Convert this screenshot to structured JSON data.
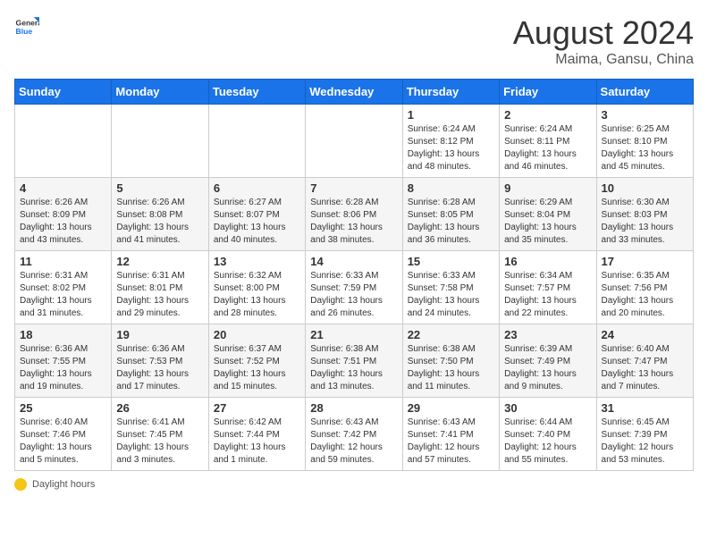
{
  "header": {
    "logo_general": "General",
    "logo_blue": "Blue",
    "month_year": "August 2024",
    "location": "Maima, Gansu, China"
  },
  "weekdays": [
    "Sunday",
    "Monday",
    "Tuesday",
    "Wednesday",
    "Thursday",
    "Friday",
    "Saturday"
  ],
  "footer": {
    "daylight_label": "Daylight hours"
  },
  "weeks": [
    [
      {
        "day": "",
        "info": ""
      },
      {
        "day": "",
        "info": ""
      },
      {
        "day": "",
        "info": ""
      },
      {
        "day": "",
        "info": ""
      },
      {
        "day": "1",
        "info": "Sunrise: 6:24 AM\nSunset: 8:12 PM\nDaylight: 13 hours\nand 48 minutes."
      },
      {
        "day": "2",
        "info": "Sunrise: 6:24 AM\nSunset: 8:11 PM\nDaylight: 13 hours\nand 46 minutes."
      },
      {
        "day": "3",
        "info": "Sunrise: 6:25 AM\nSunset: 8:10 PM\nDaylight: 13 hours\nand 45 minutes."
      }
    ],
    [
      {
        "day": "4",
        "info": "Sunrise: 6:26 AM\nSunset: 8:09 PM\nDaylight: 13 hours\nand 43 minutes."
      },
      {
        "day": "5",
        "info": "Sunrise: 6:26 AM\nSunset: 8:08 PM\nDaylight: 13 hours\nand 41 minutes."
      },
      {
        "day": "6",
        "info": "Sunrise: 6:27 AM\nSunset: 8:07 PM\nDaylight: 13 hours\nand 40 minutes."
      },
      {
        "day": "7",
        "info": "Sunrise: 6:28 AM\nSunset: 8:06 PM\nDaylight: 13 hours\nand 38 minutes."
      },
      {
        "day": "8",
        "info": "Sunrise: 6:28 AM\nSunset: 8:05 PM\nDaylight: 13 hours\nand 36 minutes."
      },
      {
        "day": "9",
        "info": "Sunrise: 6:29 AM\nSunset: 8:04 PM\nDaylight: 13 hours\nand 35 minutes."
      },
      {
        "day": "10",
        "info": "Sunrise: 6:30 AM\nSunset: 8:03 PM\nDaylight: 13 hours\nand 33 minutes."
      }
    ],
    [
      {
        "day": "11",
        "info": "Sunrise: 6:31 AM\nSunset: 8:02 PM\nDaylight: 13 hours\nand 31 minutes."
      },
      {
        "day": "12",
        "info": "Sunrise: 6:31 AM\nSunset: 8:01 PM\nDaylight: 13 hours\nand 29 minutes."
      },
      {
        "day": "13",
        "info": "Sunrise: 6:32 AM\nSunset: 8:00 PM\nDaylight: 13 hours\nand 28 minutes."
      },
      {
        "day": "14",
        "info": "Sunrise: 6:33 AM\nSunset: 7:59 PM\nDaylight: 13 hours\nand 26 minutes."
      },
      {
        "day": "15",
        "info": "Sunrise: 6:33 AM\nSunset: 7:58 PM\nDaylight: 13 hours\nand 24 minutes."
      },
      {
        "day": "16",
        "info": "Sunrise: 6:34 AM\nSunset: 7:57 PM\nDaylight: 13 hours\nand 22 minutes."
      },
      {
        "day": "17",
        "info": "Sunrise: 6:35 AM\nSunset: 7:56 PM\nDaylight: 13 hours\nand 20 minutes."
      }
    ],
    [
      {
        "day": "18",
        "info": "Sunrise: 6:36 AM\nSunset: 7:55 PM\nDaylight: 13 hours\nand 19 minutes."
      },
      {
        "day": "19",
        "info": "Sunrise: 6:36 AM\nSunset: 7:53 PM\nDaylight: 13 hours\nand 17 minutes."
      },
      {
        "day": "20",
        "info": "Sunrise: 6:37 AM\nSunset: 7:52 PM\nDaylight: 13 hours\nand 15 minutes."
      },
      {
        "day": "21",
        "info": "Sunrise: 6:38 AM\nSunset: 7:51 PM\nDaylight: 13 hours\nand 13 minutes."
      },
      {
        "day": "22",
        "info": "Sunrise: 6:38 AM\nSunset: 7:50 PM\nDaylight: 13 hours\nand 11 minutes."
      },
      {
        "day": "23",
        "info": "Sunrise: 6:39 AM\nSunset: 7:49 PM\nDaylight: 13 hours\nand 9 minutes."
      },
      {
        "day": "24",
        "info": "Sunrise: 6:40 AM\nSunset: 7:47 PM\nDaylight: 13 hours\nand 7 minutes."
      }
    ],
    [
      {
        "day": "25",
        "info": "Sunrise: 6:40 AM\nSunset: 7:46 PM\nDaylight: 13 hours\nand 5 minutes."
      },
      {
        "day": "26",
        "info": "Sunrise: 6:41 AM\nSunset: 7:45 PM\nDaylight: 13 hours\nand 3 minutes."
      },
      {
        "day": "27",
        "info": "Sunrise: 6:42 AM\nSunset: 7:44 PM\nDaylight: 13 hours\nand 1 minute."
      },
      {
        "day": "28",
        "info": "Sunrise: 6:43 AM\nSunset: 7:42 PM\nDaylight: 12 hours\nand 59 minutes."
      },
      {
        "day": "29",
        "info": "Sunrise: 6:43 AM\nSunset: 7:41 PM\nDaylight: 12 hours\nand 57 minutes."
      },
      {
        "day": "30",
        "info": "Sunrise: 6:44 AM\nSunset: 7:40 PM\nDaylight: 12 hours\nand 55 minutes."
      },
      {
        "day": "31",
        "info": "Sunrise: 6:45 AM\nSunset: 7:39 PM\nDaylight: 12 hours\nand 53 minutes."
      }
    ]
  ]
}
